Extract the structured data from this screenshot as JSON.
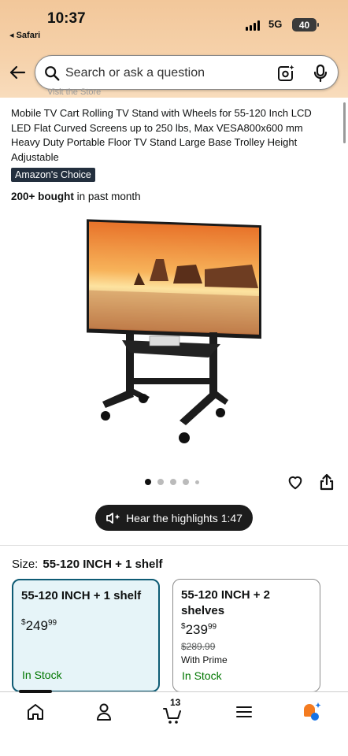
{
  "status_bar": {
    "time": "10:37",
    "back_app": "◂ Safari",
    "network": "5G",
    "battery": "40"
  },
  "search": {
    "placeholder": "Search or ask a question"
  },
  "cutoff_text": "Visit the Store",
  "product": {
    "title": "Mobile TV Cart Rolling TV Stand with Wheels for 55-120 Inch LCD LED Flat Curved Screens up to 250 lbs, Max VESA800x600 mm Heavy Duty Portable Floor TV Stand Large Base Trolley Height Adjustable",
    "badge": "Amazon's Choice",
    "bought_bold": "200+ bought",
    "bought_rest": " in past month",
    "image_count": 5,
    "active_image": 1
  },
  "highlights_button": "Hear the highlights 1:47",
  "size": {
    "label": "Size:",
    "selected": "55-120 INCH + 1 shelf",
    "options": [
      {
        "name": "55-120 INCH + 1 shelf",
        "price_whole": "249",
        "price_cents": "99",
        "currency": "$",
        "stock": "In Stock"
      },
      {
        "name": "55-120 INCH + 2 shelves",
        "price_whole": "239",
        "price_cents": "99",
        "currency": "$",
        "list_price": "$289.99",
        "prime": "With Prime",
        "stock": "In Stock"
      }
    ]
  },
  "bottom_nav": {
    "items": [
      "home-icon",
      "account-icon",
      "cart-icon",
      "menu-icon",
      "rufus-icon"
    ],
    "cart_count": "13"
  },
  "colors": {
    "header": "#f4cda3",
    "badge": "#232f3e",
    "selected_border": "#0e5b74",
    "in_stock": "#007600"
  }
}
